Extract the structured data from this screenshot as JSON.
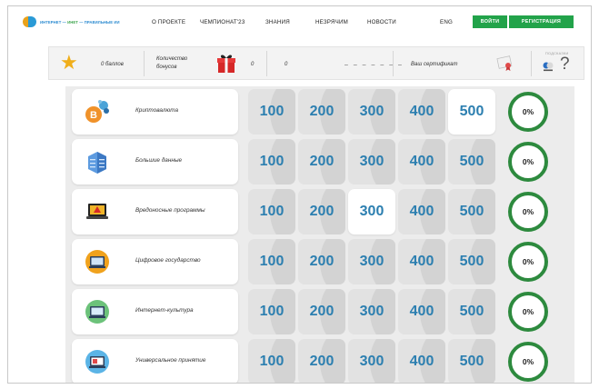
{
  "nav": {
    "logo_text_1": "ИНТЕРНЕТ — ",
    "logo_text_2": "ИНЕТ",
    "logo_text_3": " — ПРАВИЛЬНЫЕ ИИ",
    "items": [
      "О ПРОЕКТЕ",
      "ЧЕМПИОНАТ'23",
      "ЗНАНИЯ",
      "НЕЗРЯЧИМ",
      "НОВОСТИ",
      "ENG"
    ],
    "login": "ВОЙТИ",
    "register": "РЕГИСТРАЦИЯ"
  },
  "stats": {
    "points": "0 баллов",
    "bonus_label_1": "Количество",
    "bonus_label_2": "бонусов",
    "bonus_count": "0",
    "second_value": "0",
    "dashes": "– – – – – – –",
    "certificate": "Ваш сертификат",
    "hints": "ПОДСКАЗКИ"
  },
  "board": {
    "values": [
      "100",
      "200",
      "300",
      "400",
      "500"
    ],
    "accent": "#2c7fb0",
    "ring": "#2d8a3e",
    "categories": [
      {
        "name": "Криптовалюта",
        "icon": "crypto-icon",
        "progress": "0%",
        "open": [
          4
        ]
      },
      {
        "name": "Большие данные",
        "icon": "data-servers-icon",
        "progress": "0%",
        "open": []
      },
      {
        "name": "Вредоносные программы",
        "icon": "malware-laptop-icon",
        "progress": "0%",
        "open": [
          2
        ]
      },
      {
        "name": "Цифровое государство",
        "icon": "digital-state-icon",
        "progress": "0%",
        "open": []
      },
      {
        "name": "Интернет-культура",
        "icon": "internet-culture-icon",
        "progress": "0%",
        "open": []
      },
      {
        "name": "Универсальное принятие",
        "icon": "universal-acceptance-icon",
        "progress": "0%",
        "open": []
      }
    ]
  }
}
